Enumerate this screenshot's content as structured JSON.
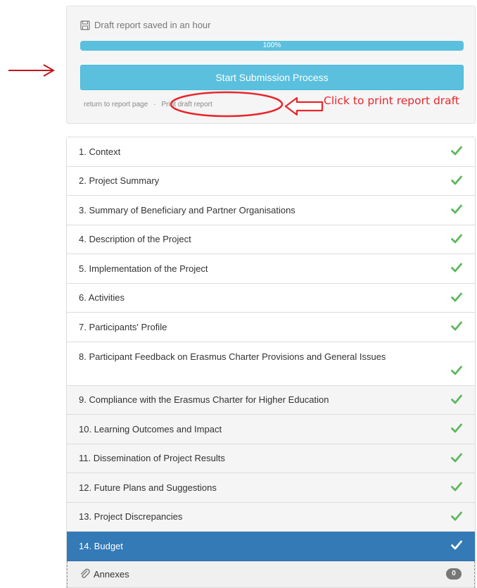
{
  "panel": {
    "save_status": "Draft report saved in an hour",
    "progress": {
      "percent": 100,
      "label": "100%"
    },
    "start_button": "Start Submission Process",
    "return_link": "return to report page",
    "separator": "·",
    "print_link": "Print draft report"
  },
  "annotation": {
    "text": "Click to print report draft",
    "color": "#e8262b"
  },
  "sections": [
    {
      "label": "1. Context",
      "complete": true
    },
    {
      "label": "2. Project Summary",
      "complete": true
    },
    {
      "label": "3. Summary of Beneficiary and Partner Organisations",
      "complete": true
    },
    {
      "label": "4. Description of the Project",
      "complete": true
    },
    {
      "label": "5. Implementation of the Project",
      "complete": true
    },
    {
      "label": "6. Activities",
      "complete": true
    },
    {
      "label": "7. Participants' Profile",
      "complete": true
    },
    {
      "label": "8. Participant Feedback on Erasmus Charter Provisions and General Issues",
      "complete": true
    },
    {
      "label": "9. Compliance with the Erasmus Charter for Higher Education",
      "complete": true
    },
    {
      "label": "10. Learning Outcomes and Impact",
      "complete": true
    },
    {
      "label": "11. Dissemination of Project Results",
      "complete": true
    },
    {
      "label": "12. Future Plans and Suggestions",
      "complete": true
    },
    {
      "label": "13. Project Discrepancies",
      "complete": true
    },
    {
      "label": "14. Budget",
      "complete": true,
      "active": true
    }
  ],
  "annexes": {
    "label": "Annexes",
    "count": "0"
  },
  "colors": {
    "accent": "#5bc0de",
    "active": "#337ab7",
    "check": "#5cb85c",
    "annotation": "#e8262b"
  }
}
